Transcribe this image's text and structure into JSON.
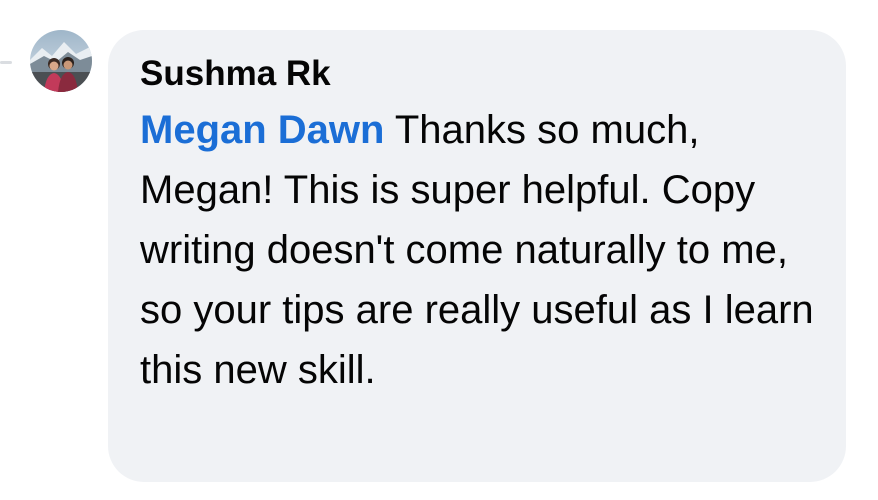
{
  "comment": {
    "avatar_icon": "user-avatar-photo",
    "author": "Sushma Rk",
    "mention": "Megan Dawn",
    "body": " Thanks so much, Megan! This is super helpful. Copy writing doesn't come naturally to me, so your tips are really useful as I learn this new skill."
  },
  "colors": {
    "bubble_background": "#f0f2f5",
    "mention": "#1b6ed6",
    "text": "#050505"
  }
}
